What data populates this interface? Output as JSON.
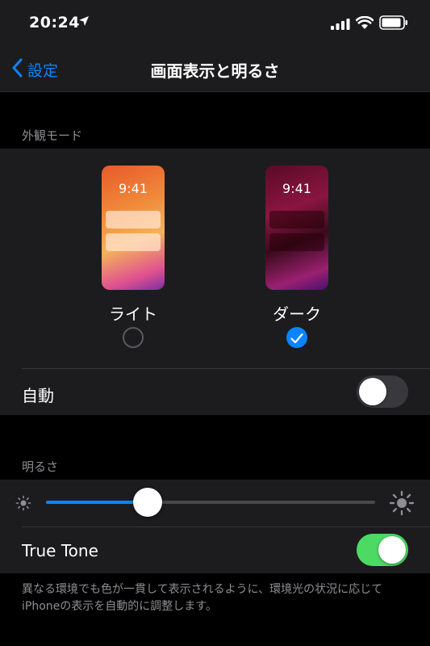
{
  "status": {
    "time": "20:24",
    "location_icon": "location-arrow-icon",
    "signal_icon": "cellular-signal-icon",
    "wifi_icon": "wifi-icon",
    "battery_icon": "battery-icon"
  },
  "nav": {
    "back_label": "設定",
    "title": "画面表示と明るさ"
  },
  "appearance": {
    "header": "外観モード",
    "options": [
      {
        "preview_time": "9:41",
        "label": "ライト",
        "selected": false
      },
      {
        "preview_time": "9:41",
        "label": "ダーク",
        "selected": true
      }
    ],
    "auto_label": "自動",
    "auto_enabled": false
  },
  "brightness": {
    "header": "明るさ",
    "level": 0.31,
    "true_tone_label": "True Tone",
    "true_tone_enabled": true,
    "footnote": "異なる環境でも色が一貫して表示されるように、環境光の状況に応じてiPhoneの表示を自動的に調整します。"
  },
  "colors": {
    "accent": "#0a84ff",
    "toggle_on": "#4cd964",
    "group_bg": "#1c1c1e",
    "secondary_text": "#8e8e93"
  }
}
